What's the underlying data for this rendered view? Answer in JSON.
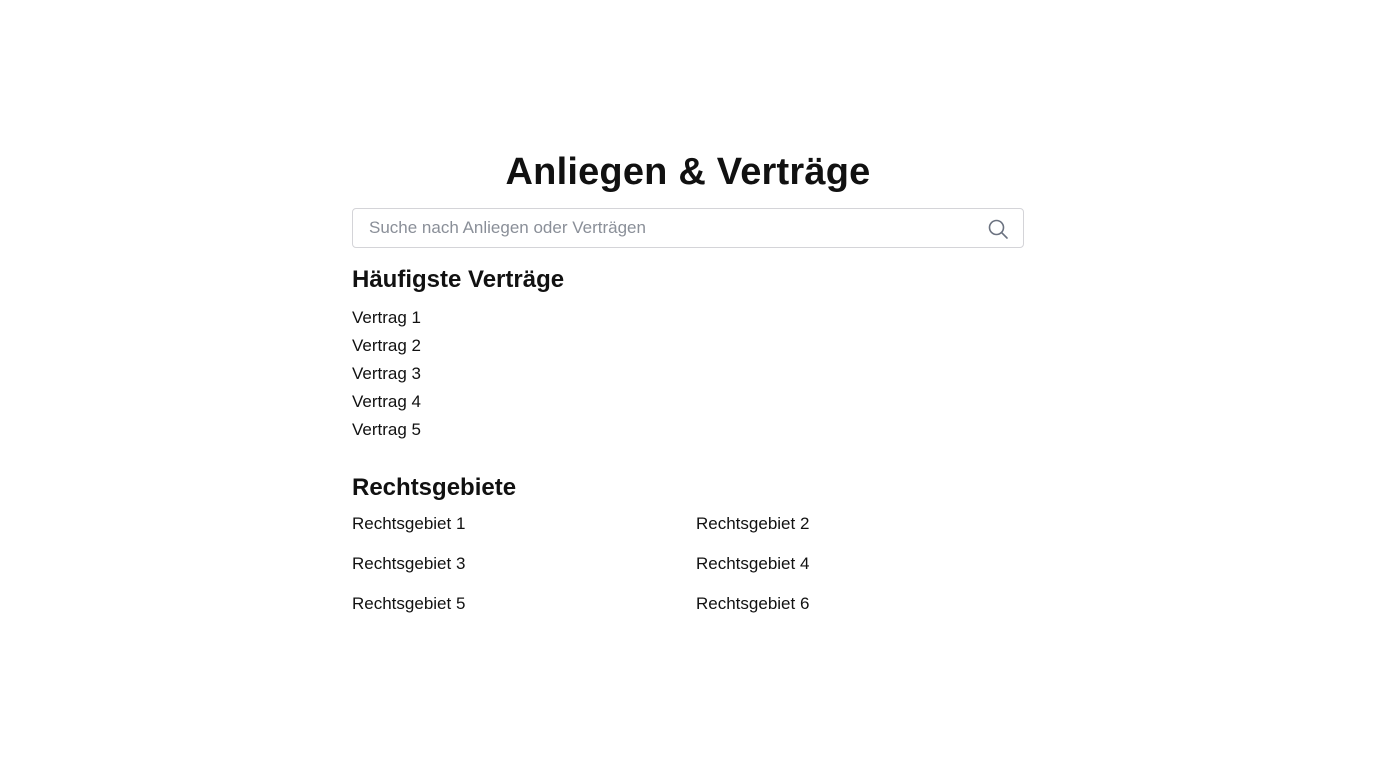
{
  "page": {
    "title": "Anliegen & Verträge"
  },
  "search": {
    "value": "",
    "placeholder": "Suche nach Anliegen oder Verträgen",
    "icon": "search-icon"
  },
  "contracts": {
    "title": "Häufigste Verträge",
    "items": [
      "Vertrag 1",
      "Vertrag 2",
      "Vertrag 3",
      "Vertrag 4",
      "Vertrag 5"
    ]
  },
  "legal_areas": {
    "title": "Rechtsgebiete",
    "items": [
      "Rechtsgebiet 1",
      "Rechtsgebiet 2",
      "Rechtsgebiet 3",
      "Rechtsgebiet 4",
      "Rechtsgebiet 5",
      "Rechtsgebiet 6"
    ]
  },
  "colors": {
    "text": "#111111",
    "placeholder": "#8a8f98",
    "border": "#d4d4d8",
    "icon": "#6b7280",
    "background": "#ffffff"
  }
}
